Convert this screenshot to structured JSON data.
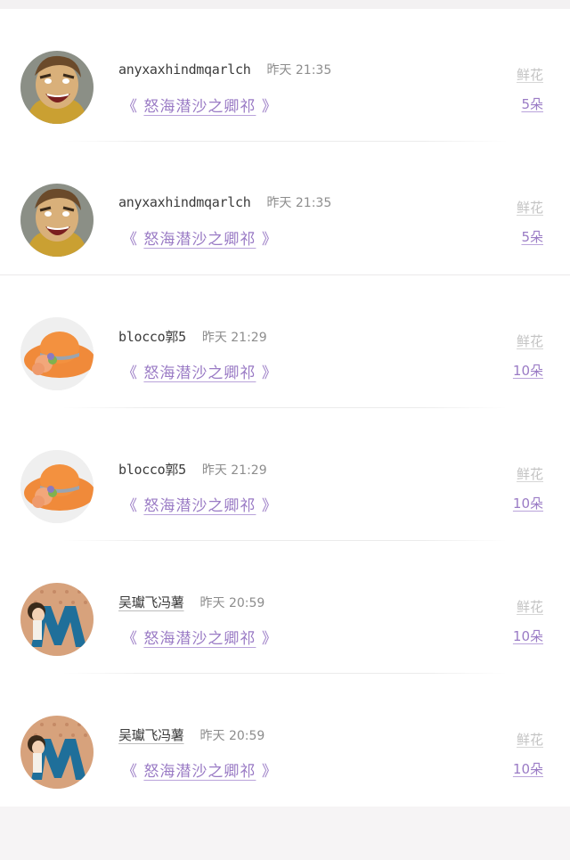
{
  "items": [
    {
      "username": "anyxaxhindmqarlch",
      "time": "昨天 21:35",
      "book_open": "《",
      "book_title": "怒海潜沙之卿祁",
      "book_close": "》",
      "flower_label": "鲜花",
      "flower_count": "5朵",
      "avatar": "cartoon-face-avatar"
    },
    {
      "username": "anyxaxhindmqarlch",
      "time": "昨天 21:35",
      "book_open": "《",
      "book_title": "怒海潜沙之卿祁",
      "book_close": "》",
      "flower_label": "鲜花",
      "flower_count": "5朵",
      "avatar": "cartoon-face-avatar"
    },
    {
      "username": "blocco郭5",
      "time": "昨天 21:29",
      "book_open": "《",
      "book_title": "怒海潜沙之卿祁",
      "book_close": "》",
      "flower_label": "鲜花",
      "flower_count": "10朵",
      "avatar": "orange-hat-avatar"
    },
    {
      "username": "blocco郭5",
      "time": "昨天 21:29",
      "book_open": "《",
      "book_title": "怒海潜沙之卿祁",
      "book_close": "》",
      "flower_label": "鲜花",
      "flower_count": "10朵",
      "avatar": "orange-hat-avatar"
    },
    {
      "username": "吴瓛飞冯薯",
      "time": "昨天 20:59",
      "book_open": "《",
      "book_title": "怒海潜沙之卿祁",
      "book_close": "》",
      "flower_label": "鲜花",
      "flower_count": "10朵",
      "avatar": "letter-m-girl-avatar"
    },
    {
      "username": "吴瓛飞冯薯",
      "time": "昨天 20:59",
      "book_open": "《",
      "book_title": "怒海潜沙之卿祁",
      "book_close": "》",
      "flower_label": "鲜花",
      "flower_count": "10朵",
      "avatar": "letter-m-girl-avatar"
    }
  ],
  "colors": {
    "accent": "#9a7bc5",
    "muted": "#8d8d8d",
    "divider": "#ebe9ea"
  }
}
